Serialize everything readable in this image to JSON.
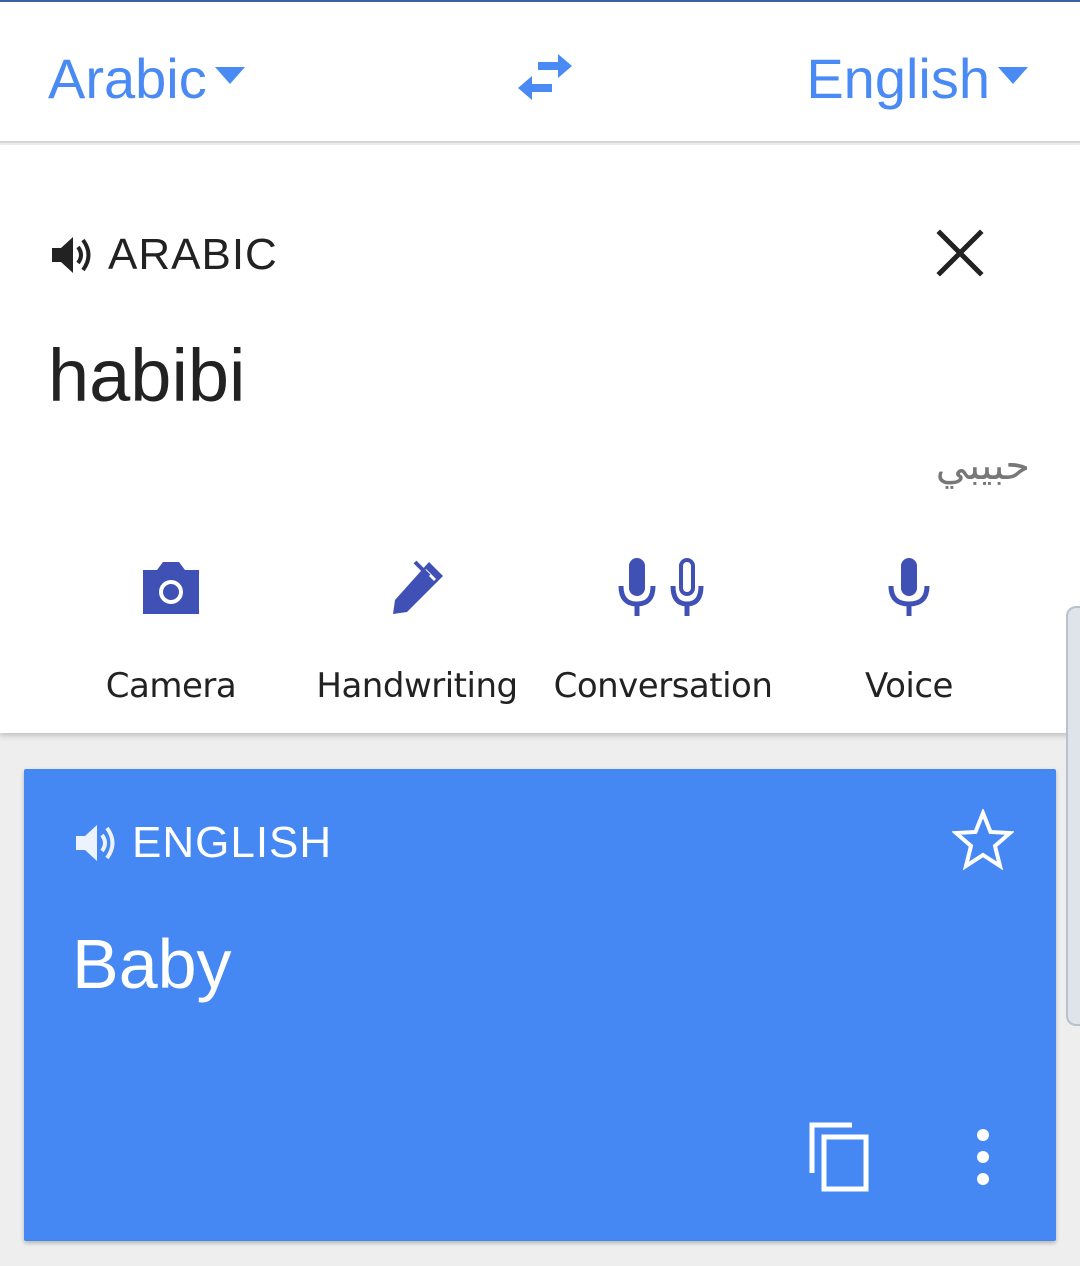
{
  "language_bar": {
    "source_language": "Arabic",
    "target_language": "English",
    "swap_icon": "swap-arrows-icon"
  },
  "input": {
    "label": "ARABIC",
    "text": "habibi",
    "transliteration": "حبيبي",
    "speaker_icon": "speaker-icon",
    "clear_icon": "close-icon"
  },
  "tools": [
    {
      "label": "Camera",
      "icon": "camera-icon"
    },
    {
      "label": "Handwriting",
      "icon": "pen-icon"
    },
    {
      "label": "Conversation",
      "icon": "dual-microphone-icon"
    },
    {
      "label": "Voice",
      "icon": "microphone-icon"
    }
  ],
  "result": {
    "label": "ENGLISH",
    "text": "Baby",
    "star_icon": "star-outline-icon",
    "copy_icon": "copy-icon",
    "more_icon": "more-vert-icon"
  },
  "colors": {
    "accent": "#4a8af4",
    "result_background": "#4588f3",
    "tool_icon": "#3f51b5"
  }
}
